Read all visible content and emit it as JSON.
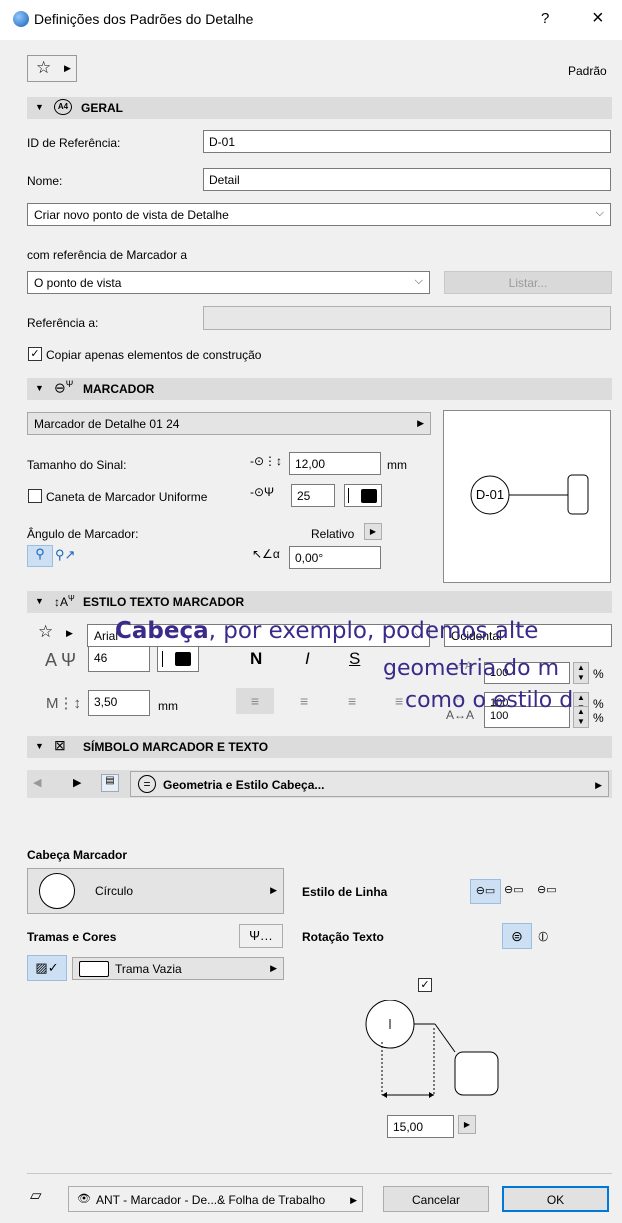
{
  "window": {
    "title": "Definições dos Padrões do Detalhe",
    "help": "?",
    "close": "×"
  },
  "header": {
    "favorites_icon": "star-icon",
    "preset": "Padrão"
  },
  "geral": {
    "section": "GERAL",
    "ref_id_label": "ID de Referência:",
    "ref_id_value": "D-01",
    "name_label": "Nome:",
    "name_value": "Detail",
    "create_option": "Criar novo ponto de vista de Detalhe",
    "marker_ref_label": "com referência de Marcador a",
    "marker_ref_value": "O ponto de vista",
    "list_button": "Listar...",
    "ref_to_label": "Referência a:",
    "copy_label": "Copiar apenas elementos de construção",
    "copy_checked": true
  },
  "marcador": {
    "section": "MARCADOR",
    "marker_type": "Marcador de Detalhe 01 24",
    "size_label": "Tamanho do Sinal:",
    "size_value": "12,00",
    "size_unit": "mm",
    "uniform_pen_label": "Caneta de Marcador Uniforme",
    "pen_value": "25",
    "angle_label": "Ângulo de Marcador:",
    "angle_mode": "Relativo",
    "angle_value": "0,00°",
    "preview_id": "D-01"
  },
  "estilo": {
    "section": "ESTILO TEXTO MARCADOR",
    "font": "Arial",
    "script": "Ocidental",
    "pen": "46",
    "size": "3,50",
    "unit": "mm",
    "bold": "N",
    "italic": "I",
    "underline": "S",
    "width_pct": "100",
    "spacing_pct": "100",
    "scale_pct": "100",
    "pct": "%",
    "caption_bold": "Cabeça",
    "caption_line1": ", por exemplo, podemos alte",
    "caption_line2": "geometria do m",
    "caption_line3": "como o estilo d"
  },
  "simbolo": {
    "section": "SÍMBOLO MARCADOR E TEXTO",
    "page": "Geometria e Estilo Cabeça...",
    "head_label": "Cabeça Marcador",
    "head_value": "Círculo",
    "line_style_label": "Estilo de Linha",
    "fills_label": "Tramas e Cores",
    "fill_value": "Trama Vazia",
    "text_rot_label": "Rotação Texto",
    "diagram_value": "15,00",
    "diagram_checked": true
  },
  "footer": {
    "layer": "ANT - Marcador - De...& Folha de Trabalho",
    "cancel": "Cancelar",
    "ok": "OK"
  }
}
